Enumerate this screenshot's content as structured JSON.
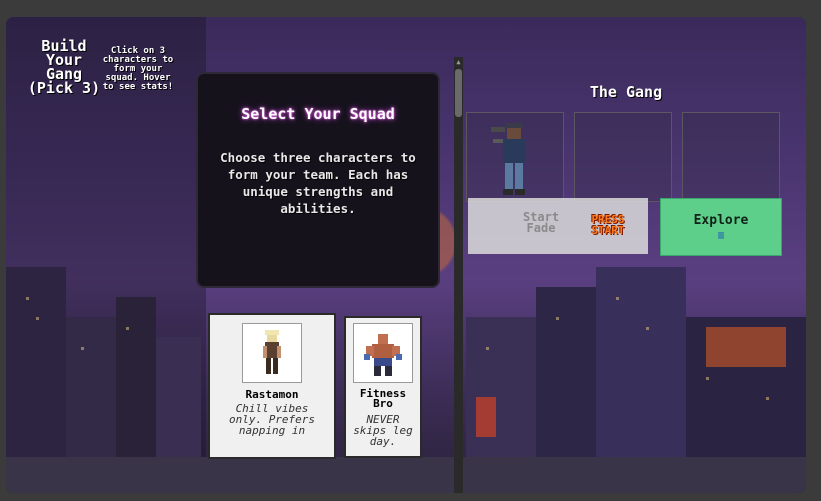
{
  "header": {
    "title": "Build Your Gang (Pick 3)",
    "hint": "Click on 3 characters to form your squad. Hover to see stats!"
  },
  "info_panel": {
    "title": "Select Your Squad",
    "body": "Choose three characters to form your team. Each has unique strengths and abilities."
  },
  "characters": [
    {
      "name": "Rastamon",
      "desc": "Chill vibes only. Prefers napping in",
      "icon": "rastamon-sprite"
    },
    {
      "name": "Fitness Bro",
      "desc": "NEVER skips leg day.",
      "icon": "fitness-bro-sprite"
    }
  ],
  "gang": {
    "title": "The Gang"
  },
  "actions": {
    "start_label": "Start Fade",
    "press_start": "PRESS START",
    "explore_label": "Explore",
    "explore_icon": "book-icon"
  },
  "colors": {
    "accent_glow": "#d04ad8",
    "explore_bg": "#5ecf8a",
    "press_start": "#ff7a1a"
  }
}
